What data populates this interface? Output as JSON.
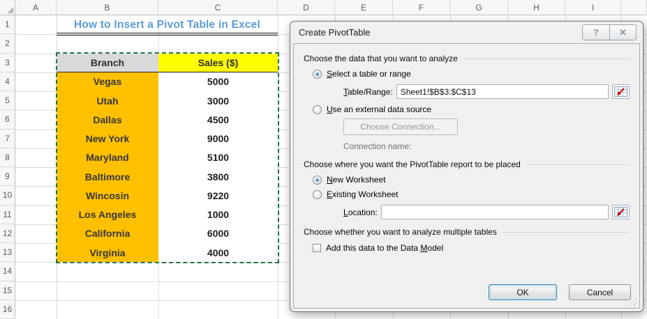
{
  "colors": {
    "accent_blue": "#5B9BD5",
    "branch_fill": "#FFC000",
    "branch_header_fill": "#D9D9D9",
    "sales_header_fill": "#FFFF00",
    "marquee_green": "#217346"
  },
  "spreadsheet": {
    "title": "How to Insert a Pivot Table in Excel",
    "col_headers": [
      "A",
      "B",
      "C",
      "D",
      "E",
      "F",
      "G",
      "H",
      "I",
      ""
    ],
    "row_headers": [
      "1",
      "2",
      "3",
      "4",
      "5",
      "6",
      "7",
      "8",
      "9",
      "10",
      "11",
      "12",
      "13",
      "14",
      "15",
      "16"
    ],
    "selected_range": "B3:C13",
    "table": {
      "header": [
        "Branch",
        "Sales ($)"
      ],
      "rows": [
        [
          "Vegas",
          "5000"
        ],
        [
          "Utah",
          "3000"
        ],
        [
          "Dallas",
          "4500"
        ],
        [
          "New York",
          "9000"
        ],
        [
          "Maryland",
          "5100"
        ],
        [
          "Baltimore",
          "3800"
        ],
        [
          "Wincosin",
          "9220"
        ],
        [
          "Los Angeles",
          "1000"
        ],
        [
          "California",
          "6000"
        ],
        [
          "Virginia",
          "4000"
        ]
      ]
    }
  },
  "dialog": {
    "title": "Create PivotTable",
    "help_glyph": "?",
    "close_glyph": "✕",
    "group1": "Choose the data that you want to analyze",
    "radio_select_table": {
      "key": "S",
      "post": "elect a table or range"
    },
    "table_range_label": {
      "key": "T",
      "post": "able/Range:"
    },
    "table_range_value": "Sheet1!$B$3:$C$13",
    "radio_external": {
      "key": "U",
      "post": "se an external data source"
    },
    "choose_connection": "Choose Connection...",
    "connection_name": "Connection name:",
    "group2": "Choose where you want the PivotTable report to be placed",
    "radio_new_ws": {
      "key": "N",
      "post": "ew Worksheet"
    },
    "radio_existing_ws": {
      "key": "E",
      "post": "xisting Worksheet"
    },
    "location_label": {
      "key": "L",
      "post": "ocation:"
    },
    "location_value": "",
    "group3": "Choose whether you want to analyze multiple tables",
    "checkbox_data_model": {
      "pre": "Add this data to the Data ",
      "key": "M",
      "post": "odel"
    },
    "ok": "OK",
    "cancel": "Cancel"
  }
}
